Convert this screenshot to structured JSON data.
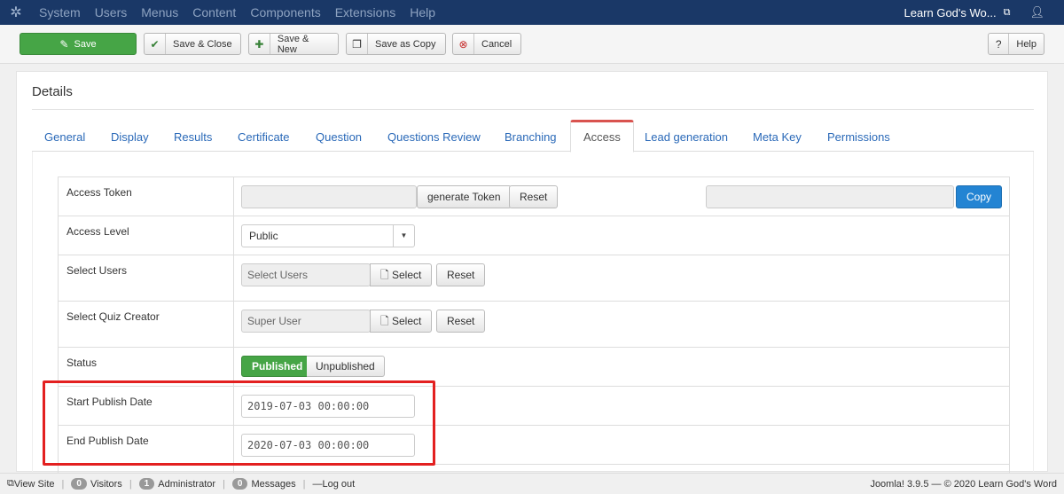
{
  "navbar": {
    "menu": [
      "System",
      "Users",
      "Menus",
      "Content",
      "Components",
      "Extensions",
      "Help"
    ],
    "site_name": "Learn God's Wo..."
  },
  "toolbar": {
    "save": "Save",
    "save_close": "Save & Close",
    "save_new": "Save & New",
    "save_copy": "Save as Copy",
    "cancel": "Cancel",
    "help": "Help"
  },
  "details": {
    "title": "Details"
  },
  "tabs": [
    {
      "label": "General"
    },
    {
      "label": "Display"
    },
    {
      "label": "Results"
    },
    {
      "label": "Certificate"
    },
    {
      "label": "Question"
    },
    {
      "label": "Questions Review"
    },
    {
      "label": "Branching"
    },
    {
      "label": "Access"
    },
    {
      "label": "Lead generation"
    },
    {
      "label": "Meta Key"
    },
    {
      "label": "Permissions"
    }
  ],
  "form": {
    "access_token": {
      "label": "Access Token",
      "value": "",
      "generate": "generate Token",
      "reset": "Reset",
      "copy_value": "",
      "copy": "Copy"
    },
    "access_level": {
      "label": "Access Level",
      "value": "Public"
    },
    "select_users": {
      "label": "Select Users",
      "placeholder": "Select Users",
      "select": "Select",
      "reset": "Reset"
    },
    "select_creator": {
      "label": "Select Quiz Creator",
      "value": "Super User",
      "select": "Select",
      "reset": "Reset"
    },
    "status": {
      "label": "Status",
      "on": "Published",
      "off": "Unpublished"
    },
    "start_date": {
      "label": "Start Publish Date",
      "value": "2019-07-03 00:00:00"
    },
    "end_date": {
      "label": "End Publish Date",
      "value": "2020-07-03 00:00:00"
    }
  },
  "statusbar": {
    "view_site": "View Site",
    "visitors_count": "0",
    "visitors": "Visitors",
    "admin_count": "1",
    "admin": "Administrator",
    "messages_count": "0",
    "messages": "Messages",
    "logout": "Log out",
    "footer": "Joomla! 3.9.5 — © 2020 Learn God's Word"
  },
  "colors": {
    "navbar": "#1a3867",
    "save_green": "#46a546",
    "copy_blue": "#2384d3",
    "highlight_red": "#e32020"
  }
}
